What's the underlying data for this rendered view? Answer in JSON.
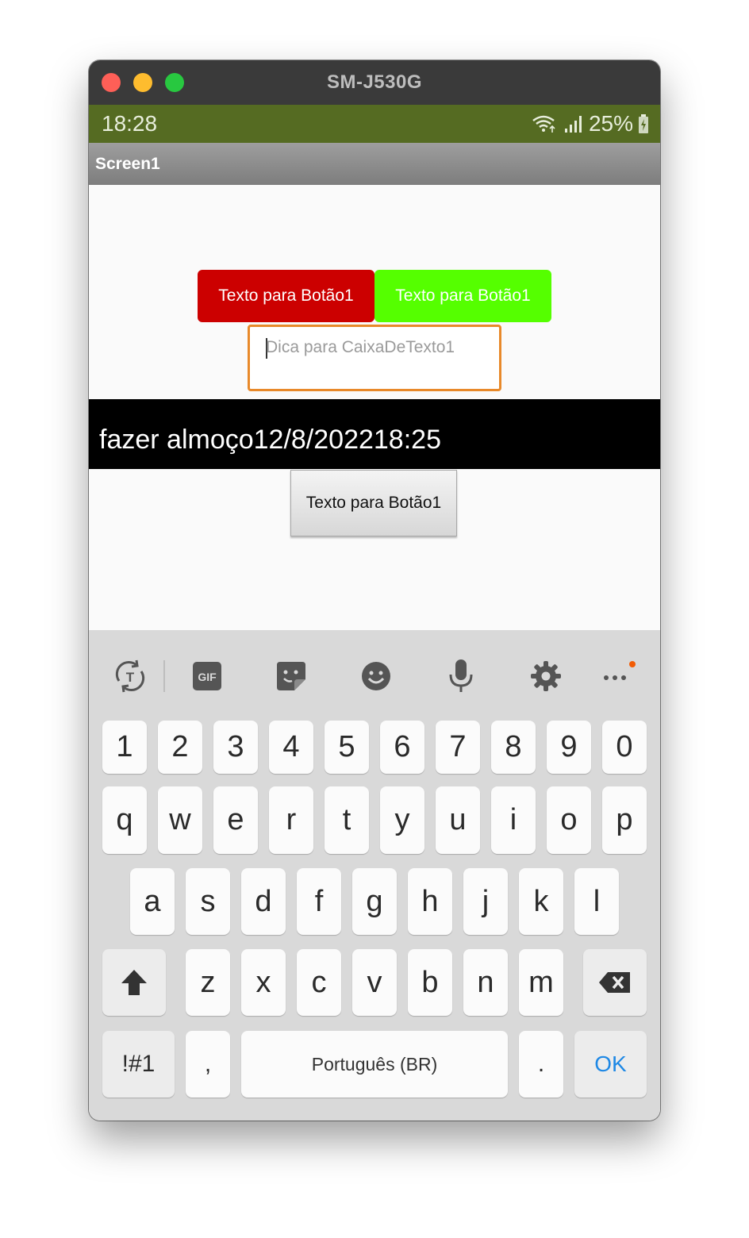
{
  "window": {
    "title": "SM-J530G"
  },
  "status_bar": {
    "time": "18:28",
    "battery": "25%",
    "wifi_icon": "wifi-icon",
    "signal_icon": "signal-icon",
    "battery_icon": "battery-charging-icon"
  },
  "app_bar": {
    "title": "Screen1"
  },
  "buttons": {
    "red": {
      "label": "Texto para Botão1",
      "color": "#cc0000"
    },
    "green": {
      "label": "Texto para Botão1",
      "color": "#55ff00"
    },
    "gray": {
      "label": "Texto para Botão1"
    }
  },
  "textbox": {
    "placeholder": "Dica para CaixaDeTexto1",
    "value": "",
    "border_color": "#e8892a"
  },
  "label": {
    "text": "fazer almoço12/8/202218:25"
  },
  "keyboard": {
    "toolbar": [
      "text-translate-icon",
      "gif-icon",
      "sticker-icon",
      "emoji-icon",
      "microphone-icon",
      "settings-gear-icon",
      "more-options-icon"
    ],
    "row_numbers": [
      "1",
      "2",
      "3",
      "4",
      "5",
      "6",
      "7",
      "8",
      "9",
      "0"
    ],
    "row_top": [
      "q",
      "w",
      "e",
      "r",
      "t",
      "y",
      "u",
      "i",
      "o",
      "p"
    ],
    "row_middle": [
      "a",
      "s",
      "d",
      "f",
      "g",
      "h",
      "j",
      "k",
      "l"
    ],
    "row_bottom": [
      "z",
      "x",
      "c",
      "v",
      "b",
      "n",
      "m"
    ],
    "symbols_label": "!#1",
    "comma_label": ",",
    "space_label": "Português (BR)",
    "period_label": ".",
    "ok_label": "OK",
    "shift_icon": "shift-arrow-icon",
    "backspace_icon": "backspace-icon"
  }
}
